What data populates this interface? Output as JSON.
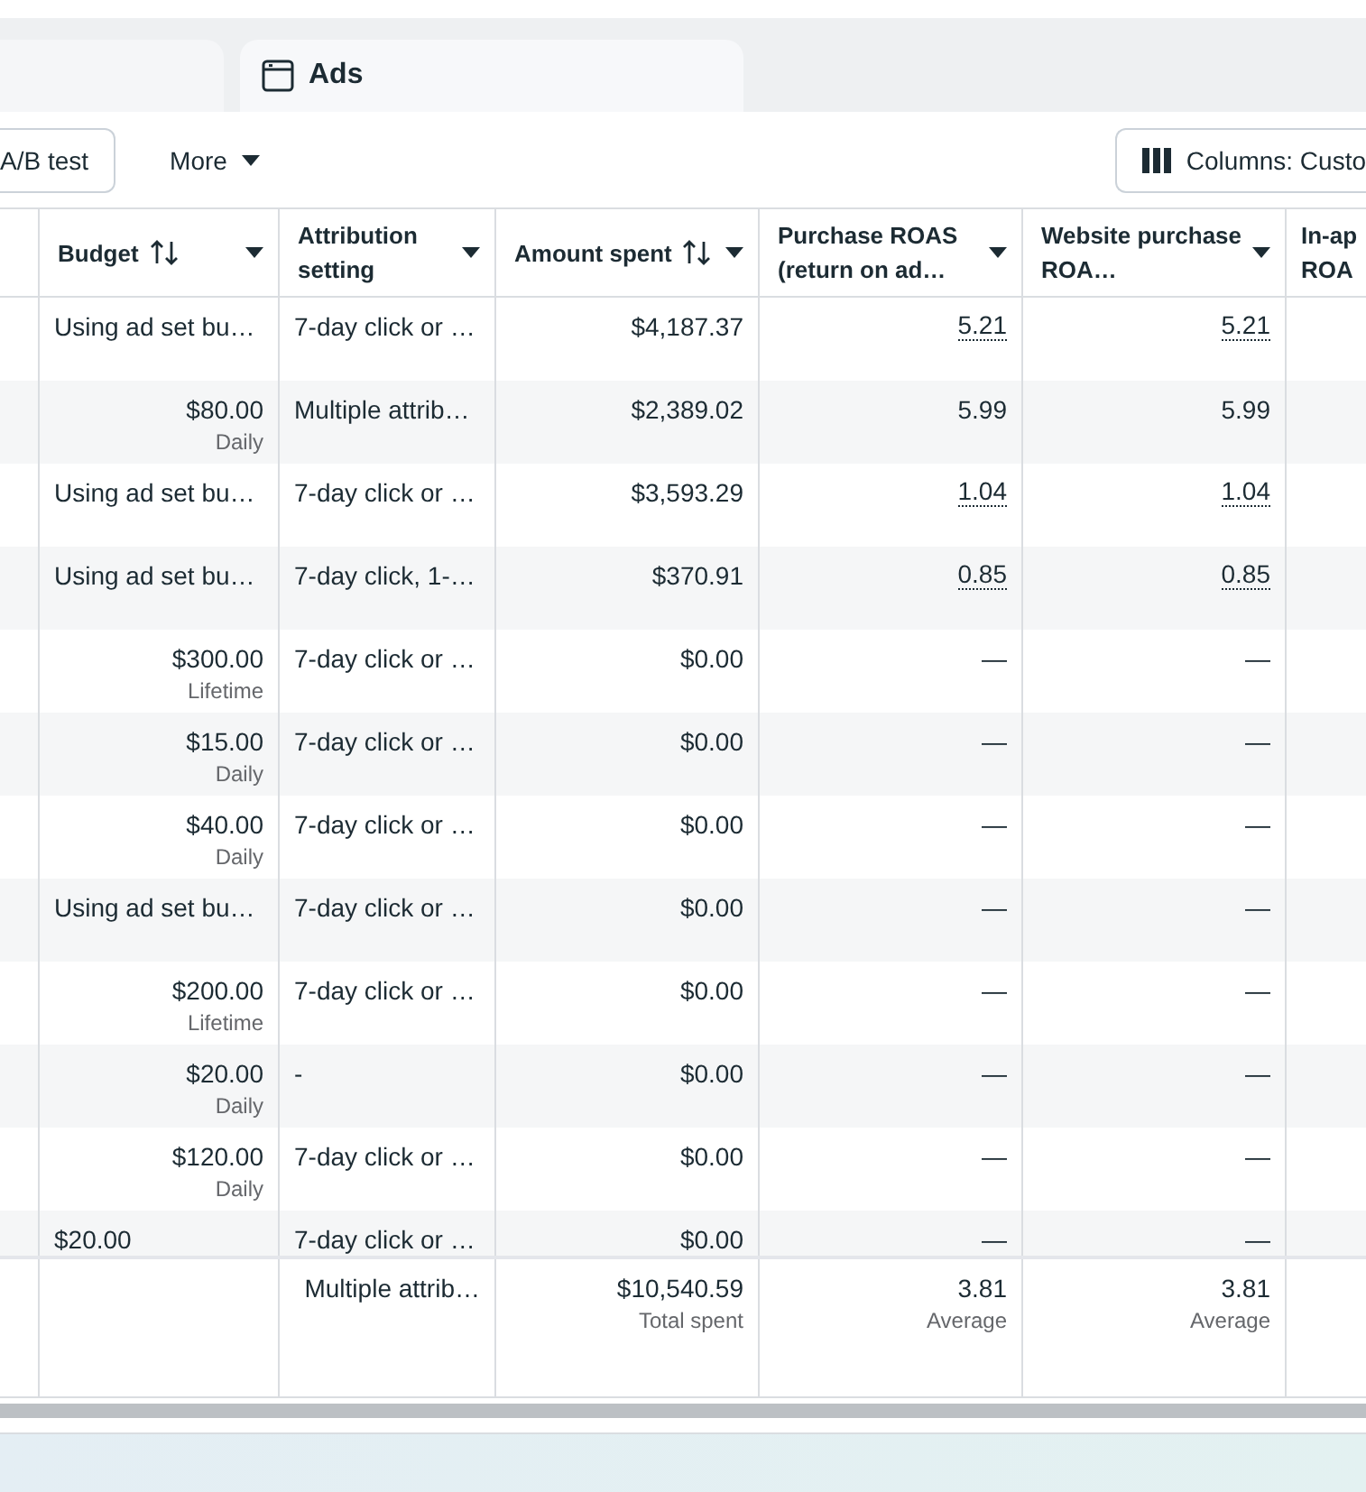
{
  "tabs": [
    {
      "selected": false
    },
    {
      "label": "Ads",
      "selected": true
    }
  ],
  "toolbar": {
    "ab_test": "A/B test",
    "more": "More",
    "columns": "Columns: Custo"
  },
  "table": {
    "columns": [
      {
        "label": "Budget",
        "sortable": true,
        "menu": true
      },
      {
        "label": "Attribution setting",
        "sortable": false,
        "menu": true
      },
      {
        "label": "Amount spent",
        "sortable": true,
        "menu": true
      },
      {
        "label": "Purchase ROAS (return on ad…",
        "sortable": false,
        "menu": true
      },
      {
        "label": "Website purchase ROA…",
        "sortable": false,
        "menu": true
      },
      {
        "label": "In-ap ROA",
        "sortable": false,
        "menu": false
      }
    ],
    "rows": [
      {
        "budget": "Using ad set bu…",
        "attribution": "7-day click or …",
        "amount": "$4,187.37",
        "purchase_roas": {
          "text": "5.21",
          "dotted": true
        },
        "website_roas": {
          "text": "5.21",
          "dotted": true
        }
      },
      {
        "budget": "$80.00",
        "budget_period": "Daily",
        "attribution": "Multiple attrib…",
        "amount": "$2,389.02",
        "purchase_roas": {
          "text": "5.99",
          "dotted": false
        },
        "website_roas": {
          "text": "5.99",
          "dotted": false
        }
      },
      {
        "budget": "Using ad set bu…",
        "attribution": "7-day click or …",
        "amount": "$3,593.29",
        "purchase_roas": {
          "text": "1.04",
          "dotted": true
        },
        "website_roas": {
          "text": "1.04",
          "dotted": true
        }
      },
      {
        "budget": "Using ad set bu…",
        "attribution": "7-day click, 1-…",
        "amount": "$370.91",
        "purchase_roas": {
          "text": "0.85",
          "dotted": true
        },
        "website_roas": {
          "text": "0.85",
          "dotted": true
        }
      },
      {
        "budget": "$300.00",
        "budget_period": "Lifetime",
        "attribution": "7-day click or …",
        "amount": "$0.00",
        "purchase_roas": {
          "text": "—",
          "dotted": false
        },
        "website_roas": {
          "text": "—",
          "dotted": false
        }
      },
      {
        "budget": "$15.00",
        "budget_period": "Daily",
        "attribution": "7-day click or …",
        "amount": "$0.00",
        "purchase_roas": {
          "text": "—",
          "dotted": false
        },
        "website_roas": {
          "text": "—",
          "dotted": false
        }
      },
      {
        "budget": "$40.00",
        "budget_period": "Daily",
        "attribution": "7-day click or …",
        "amount": "$0.00",
        "purchase_roas": {
          "text": "—",
          "dotted": false
        },
        "website_roas": {
          "text": "—",
          "dotted": false
        }
      },
      {
        "budget": "Using ad set bu…",
        "attribution": "7-day click or …",
        "amount": "$0.00",
        "purchase_roas": {
          "text": "—",
          "dotted": false
        },
        "website_roas": {
          "text": "—",
          "dotted": false
        }
      },
      {
        "budget": "$200.00",
        "budget_period": "Lifetime",
        "attribution": "7-day click or …",
        "amount": "$0.00",
        "purchase_roas": {
          "text": "—",
          "dotted": false
        },
        "website_roas": {
          "text": "—",
          "dotted": false
        }
      },
      {
        "budget": "$20.00",
        "budget_period": "Daily",
        "attribution": "-",
        "amount": "$0.00",
        "purchase_roas": {
          "text": "—",
          "dotted": false
        },
        "website_roas": {
          "text": "—",
          "dotted": false
        }
      },
      {
        "budget": "$120.00",
        "budget_period": "Daily",
        "attribution": "7-day click or …",
        "amount": "$0.00",
        "purchase_roas": {
          "text": "—",
          "dotted": false
        },
        "website_roas": {
          "text": "—",
          "dotted": false
        }
      },
      {
        "budget": "$20.00",
        "attribution": "7-day click or …",
        "amount": "$0.00",
        "purchase_roas": {
          "text": "—",
          "dotted": false
        },
        "website_roas": {
          "text": "—",
          "dotted": false
        }
      }
    ],
    "totals": {
      "attribution": "Multiple attrib…",
      "amount": "$10,540.59",
      "amount_note": "Total spent",
      "purchase_roas": "3.81",
      "purchase_roas_note": "Average",
      "website_roas": "3.81",
      "website_roas_note": "Average"
    }
  }
}
